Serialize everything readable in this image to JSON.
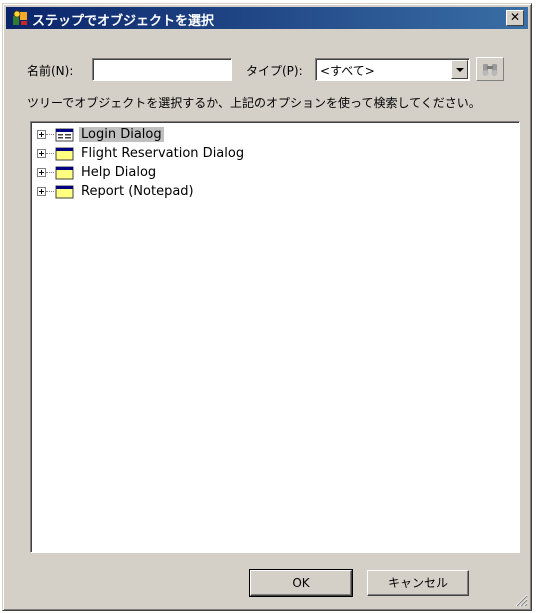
{
  "window": {
    "title": "ステップでオブジェクトを選択",
    "close_glyph": "✕"
  },
  "search": {
    "name_label": "名前(N):",
    "name_value": "",
    "type_label": "タイプ(P):",
    "type_value": "<すべて>",
    "find_icon": "binoculars-icon"
  },
  "instructions": "ツリーでオブジェクトを選択するか、上記のオプションを使って検索してください。",
  "tree": {
    "items": [
      {
        "label": "Login Dialog",
        "icon": "dialog-icon",
        "selected": true
      },
      {
        "label": "Flight Reservation Dialog",
        "icon": "window-icon",
        "selected": false
      },
      {
        "label": "Help Dialog",
        "icon": "window-icon",
        "selected": false
      },
      {
        "label": "Report (Notepad)",
        "icon": "window-icon",
        "selected": false
      }
    ]
  },
  "buttons": {
    "ok": "OK",
    "cancel": "キャンセル"
  },
  "colors": {
    "title_bar_start": "#0a246a",
    "title_bar_end": "#3a6ea5",
    "face": "#d4d0c8",
    "selection": "#c0c0c0"
  }
}
